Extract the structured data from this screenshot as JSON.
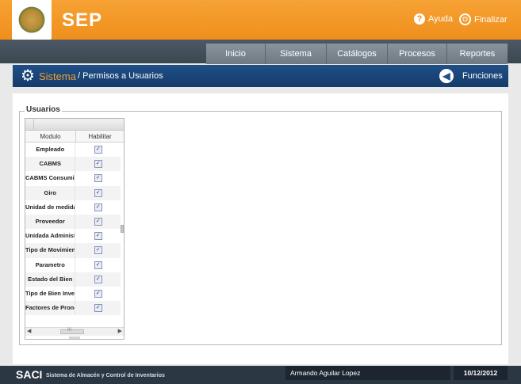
{
  "header": {
    "app_title": "SEP",
    "help_label": "Ayuda",
    "logout_label": "Finalizar"
  },
  "nav": {
    "items": [
      {
        "label": "Inicio"
      },
      {
        "label": "Sistema"
      },
      {
        "label": "Catálogos"
      },
      {
        "label": "Procesos"
      },
      {
        "label": "Reportes"
      }
    ]
  },
  "titlebar": {
    "section": "Sistema",
    "page": "/ Permisos a Usuarios",
    "functions_label": "Funciones"
  },
  "panel": {
    "legend": "Usuarios",
    "grid": {
      "columns": [
        "Modulo",
        "Habilitar"
      ],
      "rows": [
        {
          "modulo": "Empleado",
          "habilitar": true
        },
        {
          "modulo": "CABMS",
          "habilitar": true
        },
        {
          "modulo": "CABMS Consumibles",
          "habilitar": true
        },
        {
          "modulo": "Giro",
          "habilitar": true
        },
        {
          "modulo": "Unidad de medida",
          "habilitar": true
        },
        {
          "modulo": "Proveedor",
          "habilitar": true
        },
        {
          "modulo": "Unidada Administrativa",
          "habilitar": true
        },
        {
          "modulo": "Tipo de Movimiento",
          "habilitar": true
        },
        {
          "modulo": "Parametro",
          "habilitar": true
        },
        {
          "modulo": "Estado del Bien",
          "habilitar": true
        },
        {
          "modulo": "Tipo de Bien Inventario",
          "habilitar": true
        },
        {
          "modulo": "Factores de Pronóstico",
          "habilitar": true
        }
      ],
      "hscroll_thumb_label": "III"
    }
  },
  "footer": {
    "brand": "SACI",
    "subtitle": "Sistema de Almacén y Control de Inventarios",
    "user": "Armando Aguilar Lopez",
    "date": "10/12/2012"
  },
  "colors": {
    "header": "#f39a29",
    "nav": "#3f4b55",
    "titlebar": "#1c4a80",
    "section_accent": "#f0a030",
    "footer": "#2c3744"
  },
  "icons": {
    "help": "question-icon",
    "logout": "power-icon",
    "section": "gear-icon",
    "functions": "back-arrow-icon"
  }
}
